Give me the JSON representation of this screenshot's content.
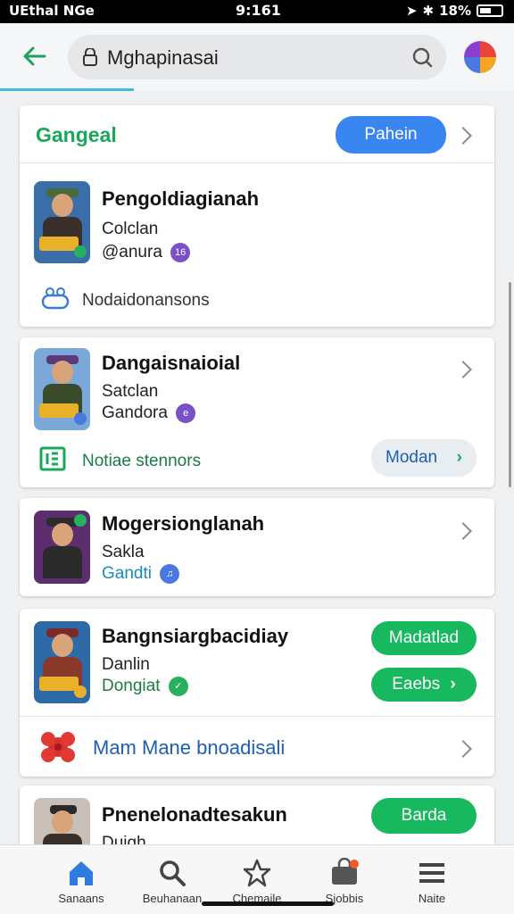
{
  "status_bar": {
    "carrier": "UEthal NGe",
    "time": "9:161",
    "battery": "18%"
  },
  "header": {
    "search_text": "Mghapinasai"
  },
  "section": {
    "title": "Gangeal",
    "button_label": "Pahein"
  },
  "apps": [
    {
      "title": "Pengoldiagianah",
      "line1": "Colclan",
      "line2": "@anura",
      "badge": "16",
      "badge_color": "#7b4fc8",
      "link_text": "Nodaidonansons",
      "thumb_colors": {
        "sky": "#3a6ea8",
        "hat": "#4a6a3a",
        "body": "#3a2f2a"
      }
    },
    {
      "title": "Dangaisnaioial",
      "line1": "Satclan",
      "line2": "Gandora",
      "badge": "e",
      "badge_color": "#7b4fc8",
      "link_text": "Notiae stennors",
      "link_button": "Modan",
      "thumb_colors": {
        "sky": "#7aa8d8",
        "hat": "#5a3a78",
        "body": "#3b4c2a"
      }
    },
    {
      "title": "Mogersionglanah",
      "line1": "Sakla",
      "line2": "Gandti",
      "badge": "♫",
      "badge_color": "#4a78e0",
      "thumb_colors": {
        "sky": "#5c2e6e",
        "hat": "#2c2c2c",
        "body": "#2a2a2a"
      }
    },
    {
      "title": "Bangnsiargbacidiay",
      "line1": "Danlin",
      "line2": "Dongiat",
      "badge": "✓",
      "badge_color": "#27b060",
      "button1": "Madatlad",
      "button2": "Eaebs",
      "link_text": "Mam Mane bnoadisali",
      "thumb_colors": {
        "sky": "#2e6aa8",
        "hat": "#7a2a2a",
        "body": "#8a3a2a"
      }
    },
    {
      "title": "Pnenelonadtesakun",
      "line1": "Duigh",
      "button1": "Barda",
      "thumb_colors": {
        "sky": "#c8c0b8",
        "hat": "#2a2a2a",
        "body": "#3a2e28"
      }
    }
  ],
  "bottom_nav": [
    {
      "label": "Sanaans",
      "icon": "home-icon"
    },
    {
      "label": "Beuhanaan",
      "icon": "search-icon"
    },
    {
      "label": "Chemaile",
      "icon": "star-icon"
    },
    {
      "label": "Sjobbis",
      "icon": "bag-icon"
    },
    {
      "label": "Naite",
      "icon": "menu-icon"
    }
  ],
  "colors": {
    "accent_green": "#18a85a",
    "accent_blue": "#3a86f0",
    "link_blue": "#1f5fb0"
  }
}
